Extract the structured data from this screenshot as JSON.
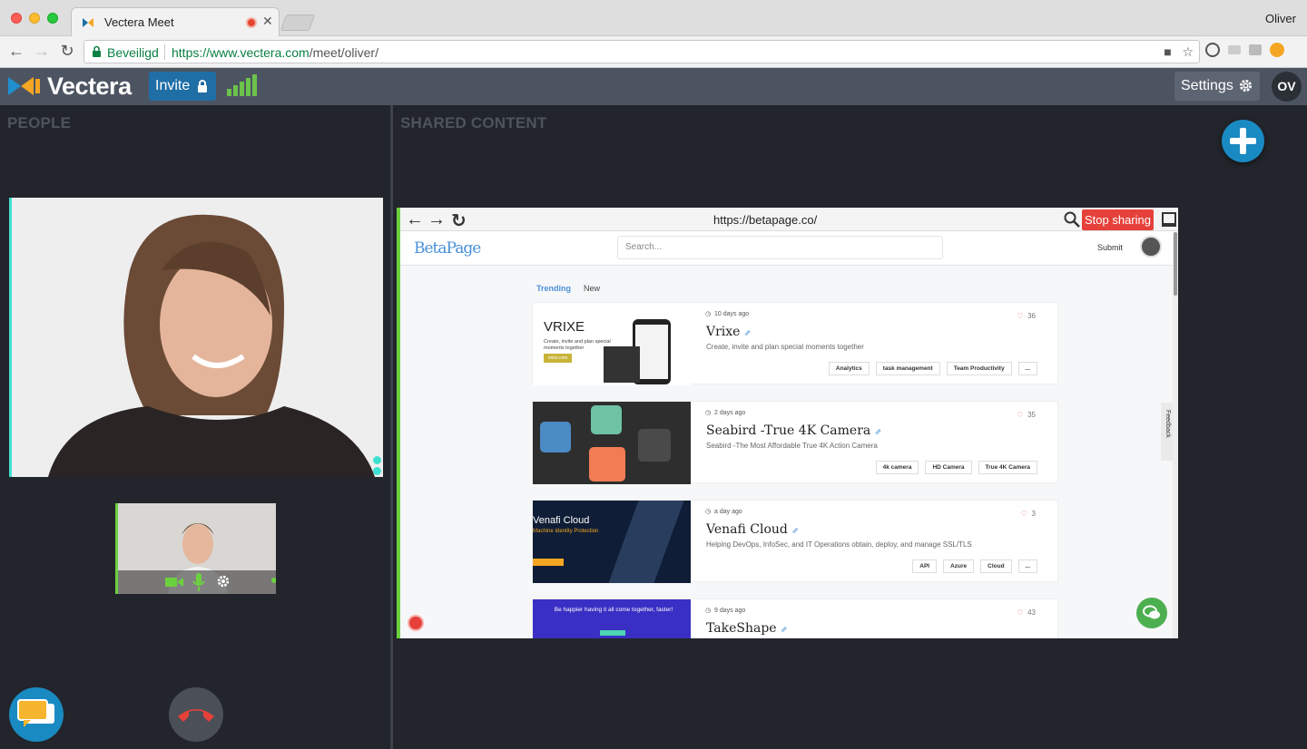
{
  "browser": {
    "tab_title": "Vectera Meet",
    "profile_name": "Oliver",
    "secure_label": "Beveiligd",
    "url_host": "https://www.vectera.com",
    "url_path": "/meet/oliver/"
  },
  "header": {
    "logo_text": "Vectera",
    "invite_label": "Invite",
    "settings_label": "Settings",
    "user_initials": "OV"
  },
  "people": {
    "title": "PEOPLE"
  },
  "shared": {
    "title": "SHARED CONTENT",
    "cobrowser": {
      "url": "https://betapage.co/",
      "stop_label": "Stop sharing"
    }
  },
  "betapage": {
    "logo": "BetaPage",
    "search_placeholder": "Search...",
    "submit_label": "Submit",
    "tabs": [
      "Trending",
      "New"
    ],
    "feedback_label": "Feedback",
    "cards": [
      {
        "time": "10 days ago",
        "title": "Vrixe",
        "desc": "Create, invite and plan special moments together",
        "likes": "36",
        "tags": [
          "Analytics",
          "task management",
          "Team Productivity",
          "..."
        ],
        "img_title": "VRIXE",
        "img_sub": "Create, invite and plan special moments together",
        "img_btn": "vrixe.com"
      },
      {
        "time": "2 days ago",
        "title": "Seabird -True 4K Camera",
        "desc": "Seabird -The Most Affordable True 4K Action Camera",
        "likes": "35",
        "tags": [
          "4k camera",
          "HD Camera",
          "True 4K Camera"
        ]
      },
      {
        "time": "a day ago",
        "title": "Venafi Cloud",
        "desc": "Helping DevOps, InfoSec, and IT Operations obtain, deploy, and manage SSL/TLS",
        "likes": "3",
        "tags": [
          "API",
          "Azure",
          "Cloud",
          "..."
        ],
        "img_title": "Venafi Cloud",
        "img_sub": "Machine Identity Protection"
      },
      {
        "time": "9 days ago",
        "title": "TakeShape",
        "likes": "43",
        "img_title": "Be happier having it all come together, faster!"
      }
    ]
  }
}
